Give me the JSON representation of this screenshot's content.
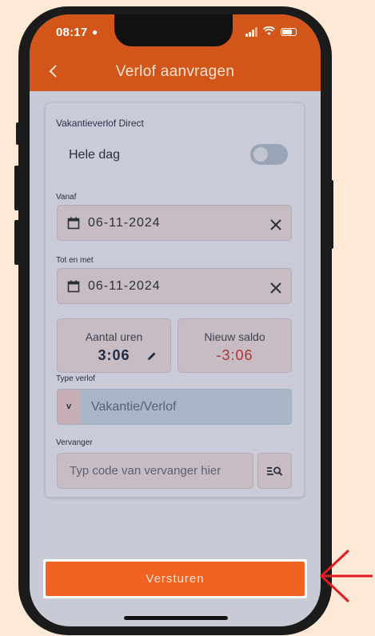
{
  "status_bar": {
    "time": "08:17",
    "person_icon": "person-icon",
    "icons": [
      "signal-icon",
      "wifi-icon",
      "battery-icon"
    ]
  },
  "header": {
    "title": "Verlof aanvragen",
    "back_icon": "chevron-left-icon"
  },
  "form": {
    "section_title": "Vakantieverlof Direct",
    "full_day": {
      "label": "Hele dag",
      "enabled": false
    },
    "from": {
      "label": "Vanaf",
      "value": "06-11-2024"
    },
    "until": {
      "label": "Tot en met",
      "value": "06-11-2024"
    },
    "hours": {
      "label": "Aantal uren",
      "value": "3:06"
    },
    "new_balance": {
      "label": "Nieuw saldo",
      "value": "-3:06"
    },
    "leave_type": {
      "label": "Type verlof",
      "prefix": "v",
      "value": "Vakantie/Verlof"
    },
    "replacement": {
      "label": "Vervanger",
      "placeholder": "Typ code van vervanger hier"
    }
  },
  "submit": {
    "label": "Versturen"
  },
  "colors": {
    "accent": "#d25519",
    "button": "#f06222",
    "highlight_arrow": "#e11d23",
    "negative": "#b03138"
  }
}
